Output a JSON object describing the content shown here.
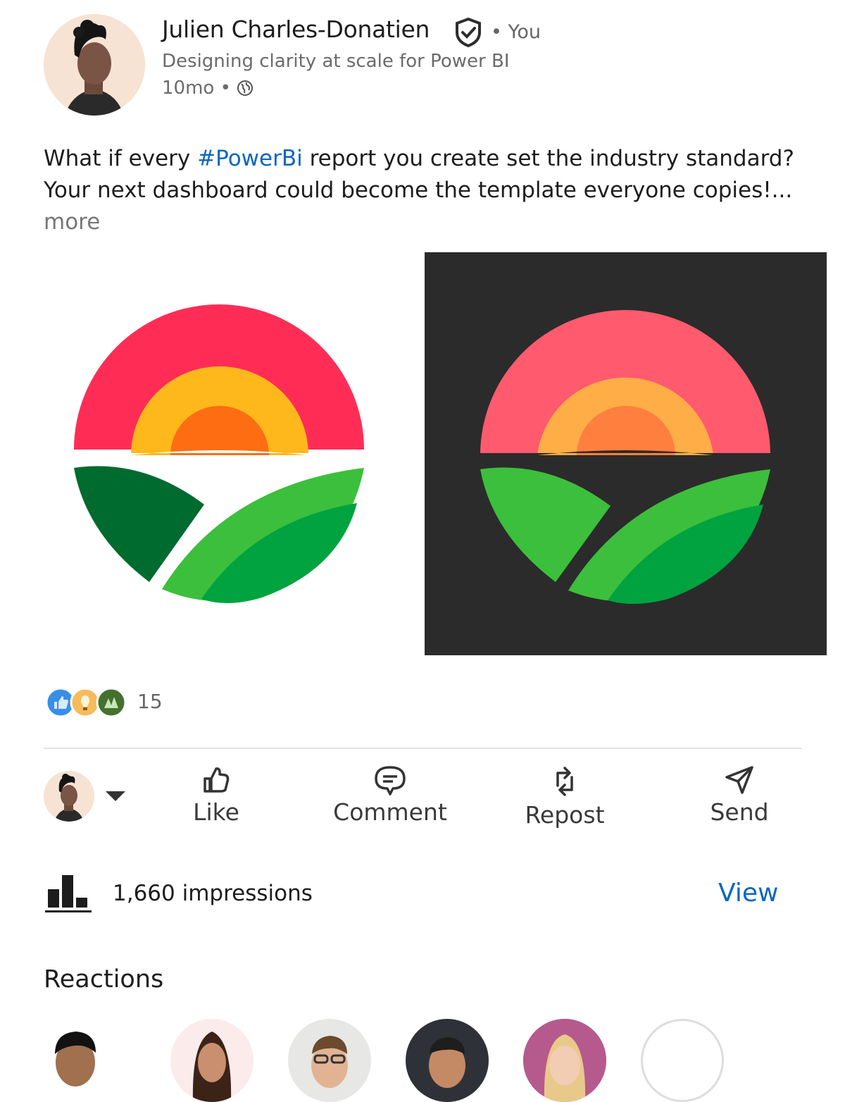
{
  "post": {
    "author_name": "Julien Charles-Donatien",
    "you_badge": "• You",
    "headline": "Designing clarity at scale for Power BI",
    "time_ago": "10mo •",
    "visibility_icon": "globe-icon",
    "text_before_hashtag": "What if every ",
    "hashtag": "#PowerBi",
    "text_after_hashtag": " report you create set the industry standard? Your next dashboard could become the template everyone copies!...",
    "more_label": "more"
  },
  "reactions_summary": {
    "icons": [
      "like-reaction-icon",
      "insightful-reaction-icon",
      "celebrate-reaction-icon"
    ],
    "count": "15"
  },
  "actions": {
    "like": "Like",
    "comment": "Comment",
    "repost": "Repost",
    "send": "Send"
  },
  "analytics": {
    "impressions": "1,660 impressions",
    "view_label": "View"
  },
  "reactions_section": {
    "title": "Reactions"
  },
  "colors": {
    "link_blue": "#0a66c2",
    "logo_red": "#ff2d55",
    "logo_yellow": "#ffb81c",
    "logo_orange": "#ff6d12",
    "logo_green_dark": "#006b2e",
    "logo_green": "#3cbf3c",
    "dark_bg": "#2b2b2b"
  }
}
